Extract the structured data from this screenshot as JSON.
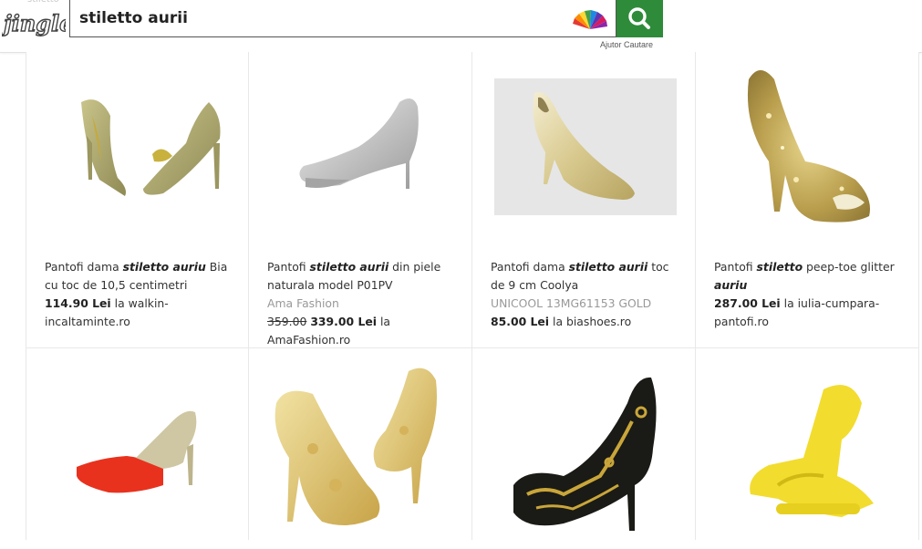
{
  "header": {
    "logo_text": "jingle",
    "ghost_text": "stiletto",
    "search": {
      "value": "stiletto aurii",
      "placeholder": ""
    },
    "search_help": "Ajutor Cautare",
    "colors": {
      "search_button": "#2e8b3a"
    }
  },
  "products": [
    {
      "title_pre": "Pantofi dama ",
      "title_em": "stiletto auriu",
      "title_post": " Bia cu toc de 10,5 centimetri",
      "merchant": "",
      "old_price": "",
      "price": "114.90 Lei",
      "store_pre": " la ",
      "store": "walkin-incaltaminte.ro"
    },
    {
      "title_pre": "Pantofi ",
      "title_em": "stiletto aurii",
      "title_post": " din piele naturala model P01PV",
      "merchant": "Ama Fashion",
      "old_price": "359.00",
      "price": "339.00 Lei",
      "store_pre": " la ",
      "store": "AmaFashion.ro"
    },
    {
      "title_pre": "Pantofi dama ",
      "title_em": "stiletto aurii",
      "title_post": " toc de 9 cm Coolya",
      "merchant": "UNICOOL 13MG61153 GOLD",
      "old_price": "",
      "price": "85.00 Lei",
      "store_pre": " la ",
      "store": "biashoes.ro"
    },
    {
      "title_pre": "Pantofi ",
      "title_em": "stiletto",
      "title_post": " peep-toe glitter ",
      "title_em2": "auriu",
      "merchant": "",
      "old_price": "",
      "price": "287.00 Lei",
      "store_pre": " la ",
      "store": "iulia-cumpara-pantofi.ro"
    }
  ]
}
